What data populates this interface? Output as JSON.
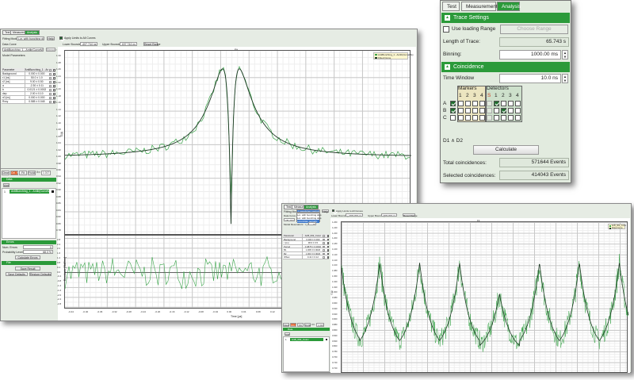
{
  "window1": {
    "tabs": [
      "Test",
      "Measurement",
      "Analysis"
    ],
    "fitting_model_label": "Fitting Model",
    "fitting_model_value": "Lor. with bunching dips",
    "help": "Help",
    "apply_limits": "Apply Limits to All Curves",
    "lower_boundary_label": "Lower Boundary",
    "lower_boundary": "-407.744 ns",
    "upper_boundary_label": "Upper Boundary",
    "upper_boundary": "497.744 ns",
    "reset_range": "Reset Range",
    "data_curve_label": "Data Curve",
    "data_curve_value": "AntiBunching_1 - Antib(CurveMe)",
    "remove": "Remove",
    "model_parameters": "Model Parameters",
    "param_header": [
      "Parameter",
      "AntiBunching_1 - Antib(CurveMe)"
    ],
    "params": [
      [
        "Background",
        "0.000 ± 0.000"
      ],
      [
        "τ1 [ns]",
        "50.0 ± 1.0"
      ],
      [
        "τ2 [ns]",
        "9.00 ± 0.50"
      ],
      [
        "a",
        "-2.30 ± 0.11"
      ],
      [
        "b",
        "0.0121 ± 0.0002"
      ],
      [
        "dep",
        "2.00 ± 0.10"
      ],
      [
        "x0 [ns]",
        "0.000 ± 0.000"
      ],
      [
        "Rxxy",
        "0.585 ± 0.048"
      ]
    ],
    "fit_buttons": [
      "Clear",
      "Ctrl. Fit",
      "Fit",
      "Fit All"
    ],
    "chi_label": "X²=",
    "chi_value": "1.017",
    "data_section": "Data",
    "add": "Add",
    "data_item_index": "1",
    "data_item": "AntiBunching_1 - Antib(CurveMe)",
    "errors_section": "Errors",
    "num_errors_label": "Num. Errors",
    "num_errors": "0",
    "prob_label": "Probability Level",
    "prob_value": "68.3 %",
    "calc_errors": "Calculate Errors",
    "file_section": "File",
    "save_result": "Save Result",
    "save_defaults": "Save Defaults",
    "restore_defaults": "Restore Defaults",
    "chart": {
      "title": "Fit",
      "ylabel": "G(t)",
      "resid_ylabel": "Residuals [StdDev.]",
      "xlabel": "Time [µs]",
      "legend": [
        "AntiBunching_1 - Antib(CurveMe)",
        "Fitted Curve"
      ],
      "y_ticks": [
        "1.30",
        "1.28",
        "1.26",
        "1.24",
        "1.22",
        "1.20",
        "1.18",
        "1.16",
        "1.14",
        "1.12",
        "1.10",
        "1.08",
        "1.06",
        "1.04",
        "1.02",
        "1.00",
        "0.98",
        "0.96",
        "0.94",
        "0.92",
        "0.90",
        "0.88",
        "0.86",
        "0.84",
        "0.82",
        "0.80",
        "0.78"
      ],
      "resid_ticks": [
        "2.8",
        "2.4",
        "2.0",
        "1.6",
        "1.2",
        "0.8",
        "0.4",
        "0.0",
        "-0.4",
        "-0.8",
        "-1.2",
        "-1.6",
        "-2.0",
        "-2.4",
        "-2.8"
      ],
      "x_ticks": [
        "-0.44",
        "-0.40",
        "-0.36",
        "-0.32",
        "-0.28",
        "-0.24",
        "-0.20",
        "-0.16",
        "-0.12",
        "-0.08",
        "-0.04",
        "0.00",
        "0.04",
        "0.08",
        "0.12"
      ]
    }
  },
  "window2": {
    "tabs": [
      "Test",
      "Measurement",
      "Analysis"
    ],
    "fitting_model_label": "Fitting Model",
    "fitting_model_value": "Lorentzian periodic",
    "dropdown_options": [
      "Lor. with bunching dips",
      "Lor. with bunching dips",
      "Lorentzian periodic"
    ],
    "help": "Help",
    "apply_limits": "Apply Limits to All Curves",
    "data_curve_label": "Data Curve",
    "data_curve_value": "AB_002_Coinc",
    "lower_boundary_label": "Lower Boundary",
    "lower_boundary": "-500.000 ns",
    "upper_boundary_label": "Upper Boundary",
    "upper_boundary": "500.000 ns",
    "reset_range": "Reset Range",
    "model_resonators": "Model Resonators : n_Peaks",
    "resonators_value": "8",
    "param_header": [
      "Parameter",
      "AnB_002_Coinc"
    ],
    "params": [
      [
        "Background",
        "0.000 ± 0.000"
      ],
      [
        "τ [ns]",
        "38.6 ± 0.5"
      ],
      [
        "Period",
        "0.0875 ± 0.0002"
      ],
      [
        "B1",
        "1.308 ± 0.0020"
      ],
      [
        "B2",
        "1.303 ± 0.0020"
      ],
      [
        "Offset",
        "0.41 ± 0.12"
      ]
    ],
    "fit_buttons": [
      "Clear",
      "Ctrl. Fit",
      "Fit",
      "Fit All"
    ],
    "chi_label": "X²=",
    "chi_value": "1.016",
    "data_section": "Data",
    "add": "Add",
    "data_item_index": "1",
    "data_item": "AnB_002_Coinc",
    "chart": {
      "title": "Fit",
      "ylabel": "G(t)",
      "legend": [
        "AnB_002_Coinc",
        "Fitted Curve"
      ],
      "y_ticks": [
        "1.260",
        "1.240",
        "1.220",
        "1.200",
        "1.180",
        "1.160",
        "1.140",
        "1.120",
        "1.100",
        "1.080",
        "1.060",
        "1.040",
        "1.020",
        "1.000",
        "0.980",
        "0.960",
        "0.940",
        "0.920",
        "0.900",
        "0.880",
        "0.860",
        "0.840",
        "0.820",
        "0.800",
        "0.780",
        "0.760",
        "0.740",
        "0.720"
      ]
    }
  },
  "panel": {
    "tabs": [
      "Test",
      "Measurement",
      "Analysis"
    ],
    "trace_settings": "Trace Settings",
    "use_loading_range": "Use loading Range",
    "choose_range": "Choose Range",
    "length_label": "Length of Trace:",
    "length_value": "65.743 s",
    "binning_label": "Binning:",
    "binning_value": "1000.00 ms",
    "coincidence": "Coincidence",
    "time_window_label": "Time Window",
    "time_window_value": "10.0 ns",
    "markers_label": "Markers",
    "detectors_label": "Detectors",
    "marker_cols": [
      "1",
      "2",
      "3",
      "4"
    ],
    "detector_cols": [
      "S",
      "1",
      "2",
      "3",
      "4"
    ],
    "rows": [
      {
        "label": "A",
        "enabled": true,
        "markers": [
          false,
          false,
          false,
          false
        ],
        "detectors": [
          false,
          true,
          false,
          false,
          false
        ]
      },
      {
        "label": "B",
        "enabled": true,
        "markers": [
          false,
          false,
          false,
          false
        ],
        "detectors": [
          false,
          false,
          true,
          false,
          false
        ]
      },
      {
        "label": "C",
        "enabled": false,
        "markers": [
          false,
          false,
          false,
          false
        ],
        "detectors": [
          false,
          false,
          false,
          false,
          false
        ]
      }
    ],
    "expression": "D1 ∧ D2",
    "calculate": "Calculate",
    "total_label": "Total coincidences:",
    "total_value": "571644 Events",
    "selected_label": "Selected coincidences:",
    "selected_value": "414043 Events"
  },
  "colors": {
    "accent": "#2b9a3a",
    "data_line": "#3aa54a",
    "fit_line": "#1f3a25",
    "ctrl_fit": "#e0602a"
  }
}
